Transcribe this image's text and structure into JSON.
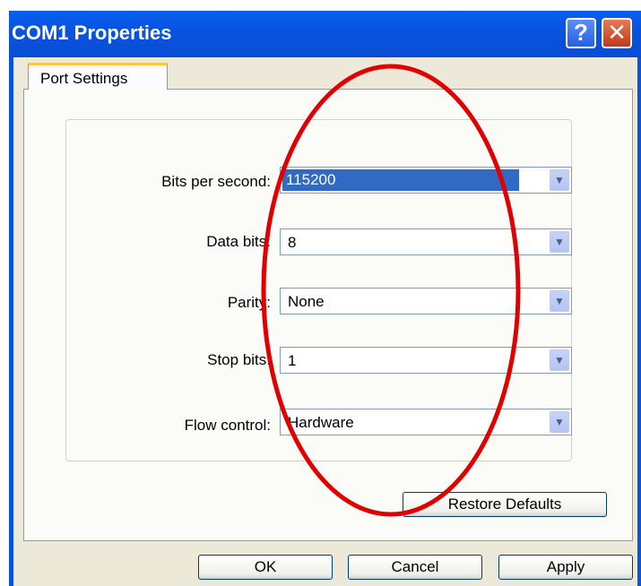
{
  "window": {
    "title": "COM1 Properties",
    "help_button": "?",
    "close_button": "✕"
  },
  "tabs": [
    {
      "label": "Port Settings",
      "selected": true
    }
  ],
  "settings": [
    {
      "label": "Bits per second:",
      "value": "115200",
      "selected": true
    },
    {
      "label": "Data bits:",
      "value": "8"
    },
    {
      "label": "Parity:",
      "value": "None"
    },
    {
      "label": "Stop bits:",
      "value": "1"
    },
    {
      "label": "Flow control:",
      "value": "Hardware"
    }
  ],
  "buttons": {
    "restore_defaults": "Restore Defaults",
    "ok": "OK",
    "cancel": "Cancel",
    "apply": "Apply"
  },
  "icons": {
    "dropdown": "chevron-down-icon"
  },
  "annotation": {
    "shape": "ellipse",
    "color": "#e00000"
  }
}
